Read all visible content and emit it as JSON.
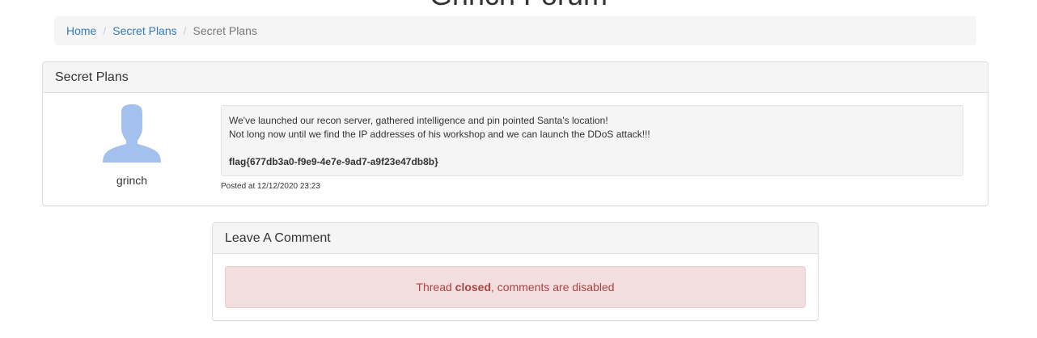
{
  "site": {
    "title": "Grinch Forum"
  },
  "breadcrumb": {
    "items": [
      {
        "label": "Home",
        "link": true
      },
      {
        "label": "Secret Plans",
        "link": true
      },
      {
        "label": "Secret Plans",
        "link": false
      }
    ],
    "separator": "/"
  },
  "thread": {
    "title": "Secret Plans",
    "post": {
      "author": "grinch",
      "avatar_icon": "user-silhouette-icon",
      "lines": [
        "We've launched our recon server, gathered intelligence and pin pointed Santa's location!",
        "Not long now until we find the IP addresses of his workshop and we can launch the DDoS attack!!!"
      ],
      "flag": "flag{677db3a0-f9e9-4e7e-9ad7-a9f23e47db8b}",
      "posted_at": "Posted at 12/12/2020 23:23"
    }
  },
  "comments": {
    "heading": "Leave A Comment",
    "alert": {
      "prefix": "Thread ",
      "emphasis": "closed",
      "suffix": ", comments are disabled"
    }
  },
  "colors": {
    "link": "#337ab7",
    "avatar": "#a3c1ec",
    "alert_bg": "#f2dede",
    "alert_text": "#a94442"
  }
}
